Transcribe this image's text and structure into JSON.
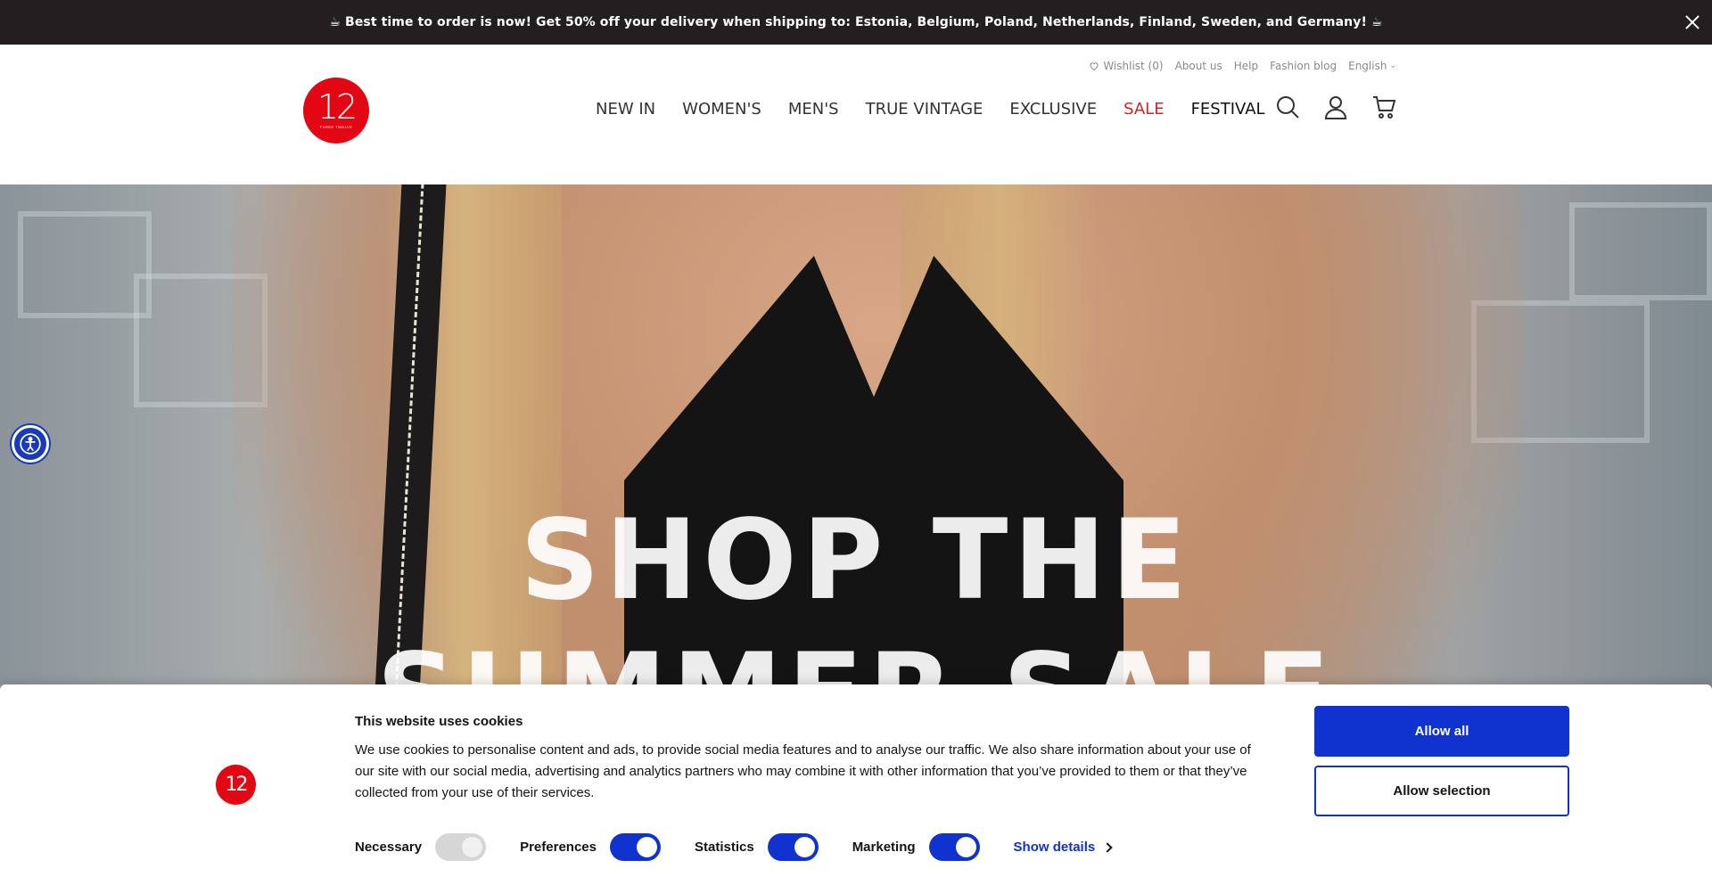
{
  "announcement": {
    "text": "☕ Best time to order is now! Get 50% off your delivery when shipping to: Estonia, Belgium, Poland, Netherlands, Finland, Sweden, and Germany! ☕",
    "close_icon": "close-icon"
  },
  "header": {
    "utility": {
      "wishlist": "Wishlist (0)",
      "about": "About us",
      "help": "Help",
      "blog": "Fashion blog",
      "language": "English"
    },
    "logo": {
      "mark": "12",
      "tagline": "THREE TWELVE"
    },
    "nav": [
      {
        "label": "NEW IN"
      },
      {
        "label": "WOMEN'S"
      },
      {
        "label": "MEN'S"
      },
      {
        "label": "TRUE VINTAGE"
      },
      {
        "label": "EXCLUSIVE"
      },
      {
        "label": "SALE"
      },
      {
        "label": "FESTIVAL"
      }
    ],
    "icons": [
      "search-icon",
      "account-icon",
      "cart-icon"
    ]
  },
  "hero": {
    "line1": "SHOP THE",
    "line2": "SUMMER SALE"
  },
  "cookie": {
    "logo_mark": "12",
    "title": "This website uses cookies",
    "body": "We use cookies to personalise content and ads, to provide social media features and to analyse our traffic. We also share information about your use of our site with our social media, advertising and analytics partners who may combine it with other information that you’ve provided to them or that they’ve collected from your use of their services.",
    "options": [
      {
        "label": "Necessary",
        "checked": true,
        "disabled": true
      },
      {
        "label": "Preferences",
        "checked": true
      },
      {
        "label": "Statistics",
        "checked": true
      },
      {
        "label": "Marketing",
        "checked": true
      }
    ],
    "show_details": "Show details",
    "allow_all": "Allow all",
    "allow_selection": "Allow selection"
  },
  "colors": {
    "brand_red": "#e30613",
    "sale_red": "#d3222a",
    "consent_blue": "#1032cf",
    "announcement_bg": "#231f20"
  }
}
